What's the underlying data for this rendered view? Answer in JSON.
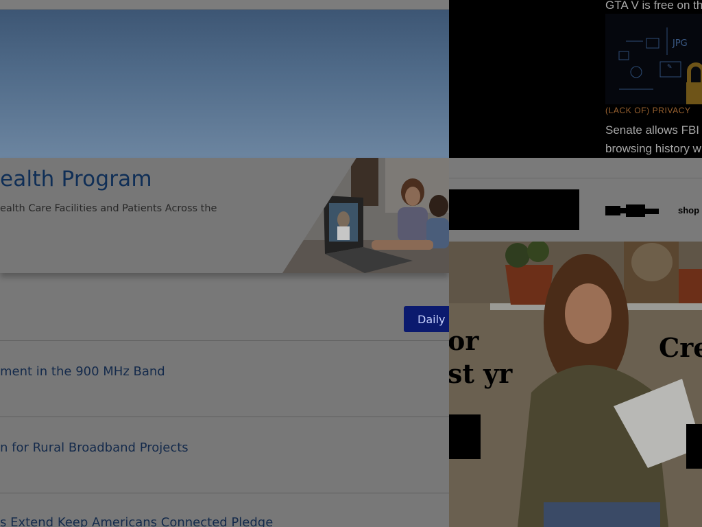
{
  "fcc_page": {
    "banner_title": "ealth Program",
    "banner_subtitle": "ealth Care Facilities and Patients Across the",
    "daily_button_label": "Daily D",
    "news_items": [
      "ment in the 900 MHz Band",
      "n for Rural Broadband Projects",
      "s Extend Keep Americans Connected Pledge"
    ]
  },
  "news_widget": {
    "headline_1": "GTA V is free on th",
    "category": "(LACK OF) PRIVACY",
    "headline_2": "Senate allows FBI browsing history w"
  },
  "ad_bar": {
    "logo_text": "shop"
  },
  "ad": {
    "headline_left_1": "or",
    "headline_left_2": "st yr",
    "headline_right": "Cre"
  }
}
